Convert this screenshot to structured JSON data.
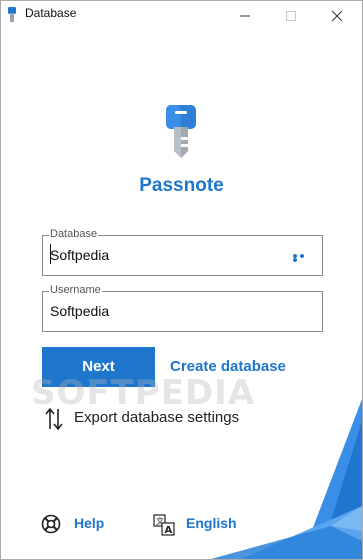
{
  "window": {
    "title": "Database",
    "minimize_icon": "minimize-icon",
    "maximize_icon": "maximize-icon",
    "close_icon": "close-icon"
  },
  "app": {
    "name": "Passnote",
    "logo_icon": "key-icon",
    "accent_color": "#1e77cc"
  },
  "form": {
    "database": {
      "legend": "Database",
      "value": "Softpedia",
      "more_icon": "more-dots-icon"
    },
    "username": {
      "legend": "Username",
      "value": "Softpedia"
    }
  },
  "actions": {
    "next_label": "Next",
    "create_database_label": "Create database",
    "export_settings_label": "Export database settings",
    "export_icon": "sort-arrows-icon"
  },
  "footer": {
    "help_label": "Help",
    "help_icon": "lifebuoy-icon",
    "language_label": "English",
    "language_icon": "translate-icon"
  },
  "watermark": "SOFTPEDIA"
}
